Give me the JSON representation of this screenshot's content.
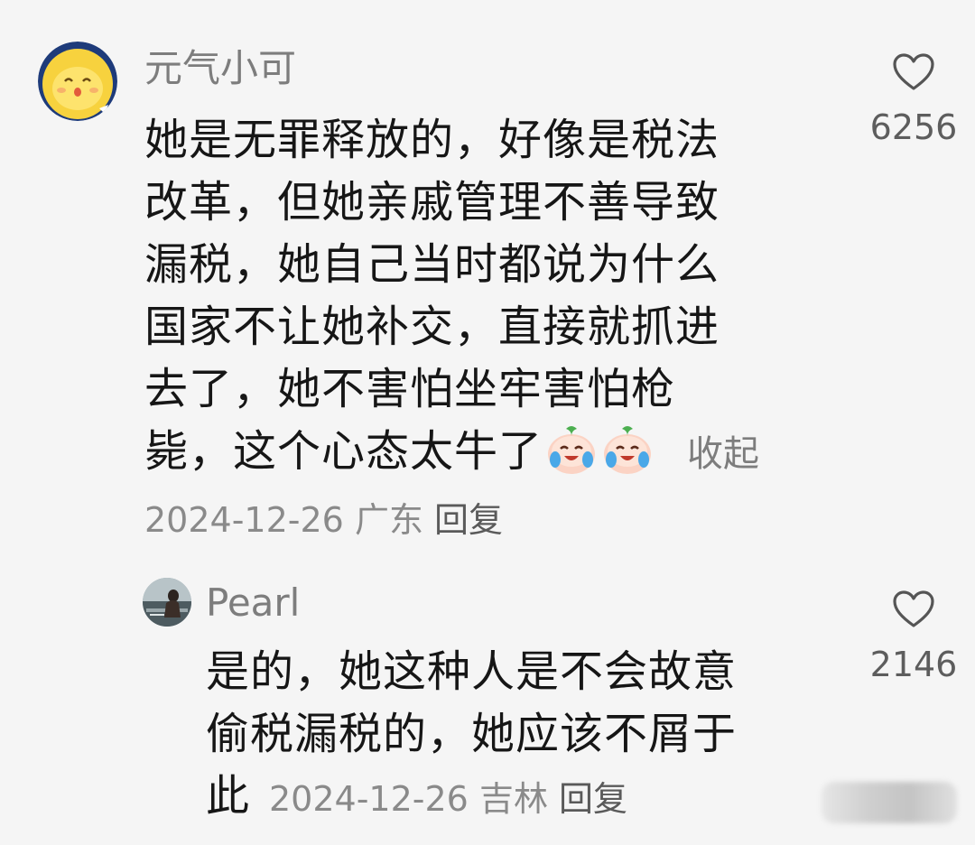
{
  "comments": [
    {
      "username": "元气小可",
      "avatar_icon": "yellow-cartoon-avatar",
      "text_lines": [
        "她是无罪释放的，好像是税法",
        "改革，但她亲戚管理不善导致",
        "漏税，她自己当时都说为什么",
        "国家不让她补交，直接就抓进",
        "去了，她不害怕坐牢害怕枪",
        "毙，这个心态太牛了"
      ],
      "emojis": [
        "crying-laughing-peach-emoji",
        "crying-laughing-peach-emoji"
      ],
      "collapse_label": "收起",
      "date": "2024-12-26",
      "location": "广东",
      "reply_label": "回复",
      "like_icon": "heart-outline-icon",
      "like_count": "6256"
    },
    {
      "username": "Pearl",
      "avatar_icon": "photo-avatar",
      "text_lines": [
        "是的，她这种人是不会故意",
        "偷税漏税的，她应该不屑于",
        "此"
      ],
      "date": "2024-12-26",
      "location": "吉林",
      "reply_label": "回复",
      "like_icon": "heart-outline-icon",
      "like_count": "2146"
    }
  ],
  "colors": {
    "background": "#f5f5f5",
    "text": "#161616",
    "secondary_text": "#7d7d7d",
    "avatar_yellow": "#f7d23e"
  }
}
